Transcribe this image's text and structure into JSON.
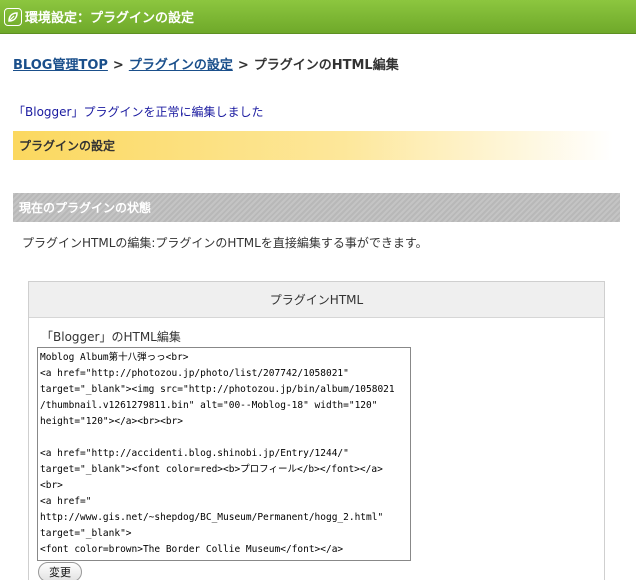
{
  "titlebar": {
    "title": "環境設定：プラグインの設定",
    "icon": "leaf-icon"
  },
  "breadcrumb": {
    "home": "BLOG管理TOP",
    "separator": ">",
    "plugin_settings": "プラグインの設定",
    "current": "プラグインのHTML編集"
  },
  "message": "「Blogger」プラグインを正常に編集しました",
  "section_plugin_settings": "プラグインの設定",
  "section_current_state": "現在のプラグインの状態",
  "description": "プラグインHTMLの編集:プラグインのHTMLを直接編集する事ができます。",
  "panel": {
    "header": "プラグインHTML",
    "edit_label": "「Blogger」のHTML編集",
    "code_lines": [
      "Moblog Album第十八弾っっ<br>",
      "<a href=\"http://photozou.jp/photo/list/207742/1058021\"",
      "target=\"_blank\"><img src=\"http://photozou.jp/bin/album/1058021",
      "/thumbnail.v1261279811.bin\" alt=\"00--Moblog-18\" width=\"120\"",
      "height=\"120\"></a><br><br>",
      "",
      "<a href=\"http://accidenti.blog.shinobi.jp/Entry/1244/\"",
      "target=\"_blank\"><font color=red><b>プロフィール</b></font></a>",
      "<br>",
      "<a href=\"",
      "http://www.gis.net/~shepdog/BC_Museum/Permanent/hogg_2.html\"",
      "target=\"_blank\">",
      "<font color=brown>The Border Collie Museum</font></a>"
    ],
    "save_label": "変更"
  },
  "colors": {
    "titlebar": "#7cb83a",
    "link": "#1a4f8b",
    "message": "#1a1aa0",
    "section_yellow": "#fbd85f",
    "section_gray": "#c4c4c4"
  }
}
